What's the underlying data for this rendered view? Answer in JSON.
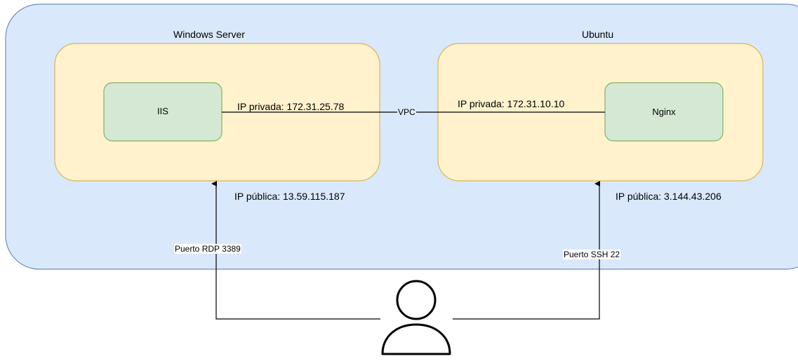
{
  "cloud": {
    "fill": "#dae8fc",
    "stroke": "#6c8ebf"
  },
  "servers": [
    {
      "title": "Windows Server",
      "fill": "#fff2cc",
      "stroke": "#d6b656",
      "app": "IIS",
      "private_ip": "IP privada: 172.31.25.78",
      "public_ip": "IP pública: 13.59.115.187"
    },
    {
      "title": "Ubuntu",
      "fill": "#fff2cc",
      "stroke": "#d6b656",
      "app": "Nginx",
      "private_ip": "IP privada: 172.31.10.10",
      "public_ip": "IP pública: 3.144.43.206"
    }
  ],
  "app_box": {
    "fill": "#d5e8d4",
    "stroke": "#82b366"
  },
  "link": {
    "label": "VPC"
  },
  "access": [
    {
      "label": "Puerto RDP 3389"
    },
    {
      "label": "Puerto SSH 22"
    }
  ],
  "user": {
    "icon": "user-icon"
  }
}
